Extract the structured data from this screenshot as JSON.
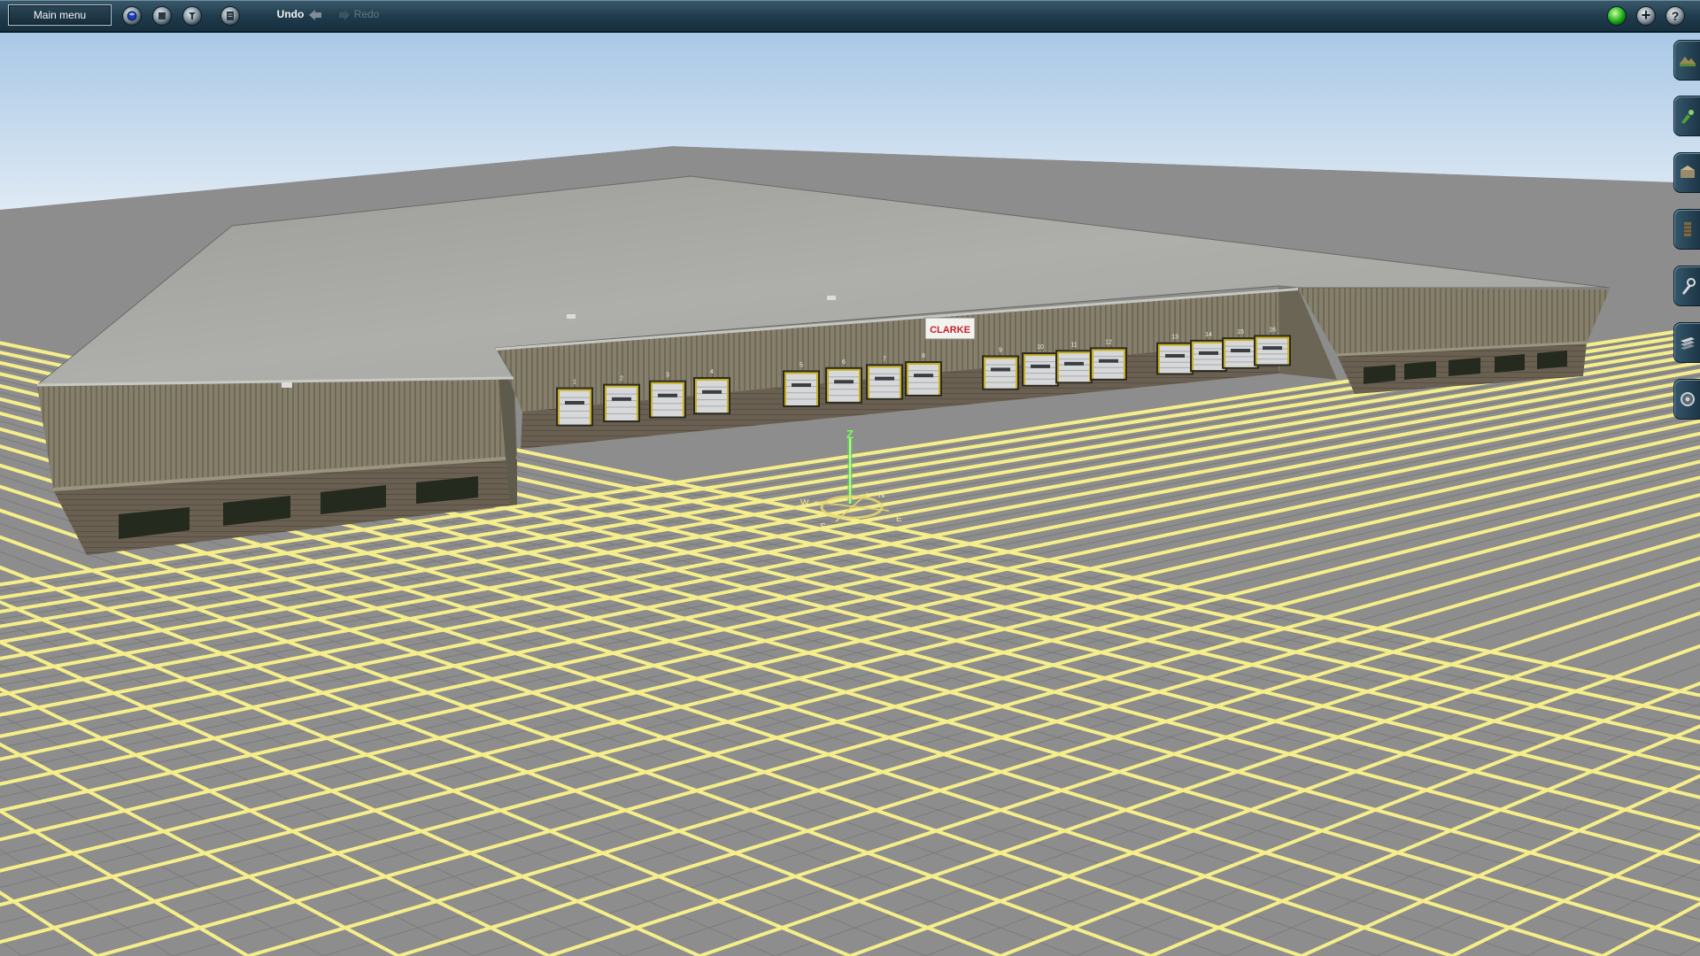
{
  "toolbar": {
    "main_menu_label": "Main menu",
    "undo_label": "Undo",
    "redo_label": "Redo",
    "help_label": "?",
    "add_label": "+",
    "icons": [
      "layers-icon",
      "stop-icon",
      "tools-icon",
      "document-icon"
    ]
  },
  "viewport": {
    "sign_text": "CLARKE",
    "compass": {
      "axis_label": "Z",
      "directions": [
        "N",
        "E",
        "S",
        "W"
      ]
    },
    "door_numbers": [
      "1",
      "2",
      "3",
      "4",
      "5",
      "6",
      "7",
      "8",
      "9",
      "10",
      "11",
      "12",
      "13",
      "14",
      "15",
      "16"
    ]
  },
  "palette": {
    "tools": [
      "terrain-tool-icon",
      "paint-tool-icon",
      "objects-tool-icon",
      "track-tool-icon",
      "wrench-tool-icon",
      "layers-tool-icon",
      "settings-tool-icon"
    ]
  },
  "colors": {
    "toolbar": "#1f3a4a",
    "grid_line": "#f6ee8a",
    "ground": "#8a8a8a",
    "sky_top": "#b8d4ec",
    "status_green": "#22b020",
    "sign_red": "#c8202a"
  }
}
